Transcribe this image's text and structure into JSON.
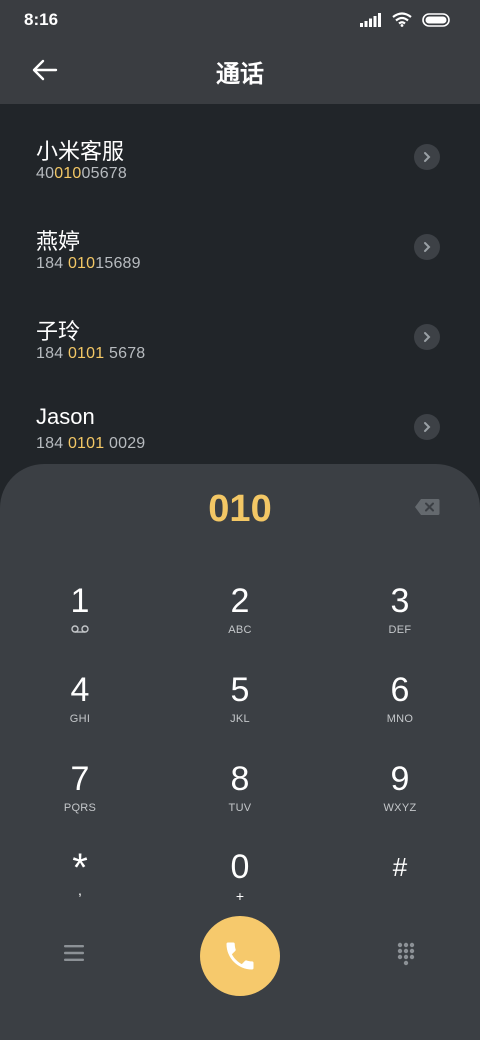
{
  "status_bar": {
    "time": "8:16"
  },
  "header": {
    "title": "通话"
  },
  "contacts": [
    {
      "name": "小米客服",
      "number_pre": "40",
      "number_hl": "010",
      "number_post": "05678"
    },
    {
      "name": "燕婷",
      "number_pre": "184 ",
      "number_hl": "010",
      "number_post": "15689"
    },
    {
      "name": "子玲",
      "number_pre": "184 ",
      "number_hl": "0101",
      "number_post": " 5678"
    },
    {
      "name": "Jason",
      "number_pre": "184 ",
      "number_hl": "0101",
      "number_post": " 0029"
    }
  ],
  "dialer": {
    "typed": "010",
    "keys": [
      {
        "num": "1",
        "letters": ""
      },
      {
        "num": "2",
        "letters": "ABC"
      },
      {
        "num": "3",
        "letters": "DEF"
      },
      {
        "num": "4",
        "letters": "GHI"
      },
      {
        "num": "5",
        "letters": "JKL"
      },
      {
        "num": "6",
        "letters": "MNO"
      },
      {
        "num": "7",
        "letters": "PQRS"
      },
      {
        "num": "8",
        "letters": "TUV"
      },
      {
        "num": "9",
        "letters": "WXYZ"
      },
      {
        "num": "*",
        "letters": ","
      },
      {
        "num": "0",
        "letters": "+"
      },
      {
        "num": "#",
        "letters": ""
      }
    ]
  },
  "colors": {
    "accent": "#f3c765",
    "call_button": "#f6c96c",
    "background": "#212529",
    "pad": "#3b3f44"
  }
}
